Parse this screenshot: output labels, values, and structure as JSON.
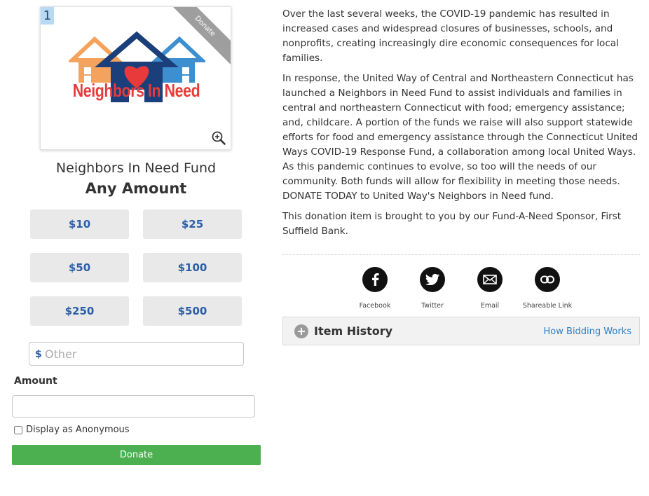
{
  "item": {
    "number": "1",
    "ribbon": "Donate",
    "logo_text": "Neighbors In Need",
    "title": "Neighbors In Need Fund",
    "amount_text": "Any Amount"
  },
  "amounts": [
    "$10",
    "$25",
    "$50",
    "$100",
    "$250",
    "$500"
  ],
  "other": {
    "currency": "$",
    "placeholder": "Other"
  },
  "form": {
    "amount_label": "Amount",
    "amount_value": "",
    "anonymous_label": "Display as Anonymous",
    "donate_label": "Donate"
  },
  "description": [
    "Over the last several weeks, the COVID-19 pandemic has resulted in increased cases and widespread closures of businesses, schools, and nonprofits, creating increasingly dire economic consequences for local families.",
    "In response, the United Way of Central and Northeastern Connecticut has launched a Neighbors in Need Fund to assist individuals and families in central and northeastern Connecticut with food; emergency assistance; and, childcare. A portion of the funds we raise will also support statewide efforts for food and emergency assistance through the Connecticut United Ways COVID-19 Response Fund, a collaboration among local United Ways. As this pandemic continues to evolve, so too will the needs of our community. Both funds will allow for flexibility in meeting those needs. DONATE TODAY to United Way's Neighbors in Need fund.",
    "This donation item is brought to you by our Fund-A-Need Sponsor, First Suffield Bank."
  ],
  "share": [
    {
      "label": "Facebook",
      "icon": "facebook-icon"
    },
    {
      "label": "Twitter",
      "icon": "twitter-icon"
    },
    {
      "label": "Email",
      "icon": "email-icon"
    },
    {
      "label": "Shareable Link",
      "icon": "link-icon"
    }
  ],
  "history": {
    "title": "Item History",
    "bidding_link": "How Bidding Works"
  },
  "colors": {
    "accent_blue": "#2c5ea8",
    "donate_green": "#4caf50",
    "logo_red": "#e83a3a",
    "link_blue": "#2b7fc4"
  }
}
